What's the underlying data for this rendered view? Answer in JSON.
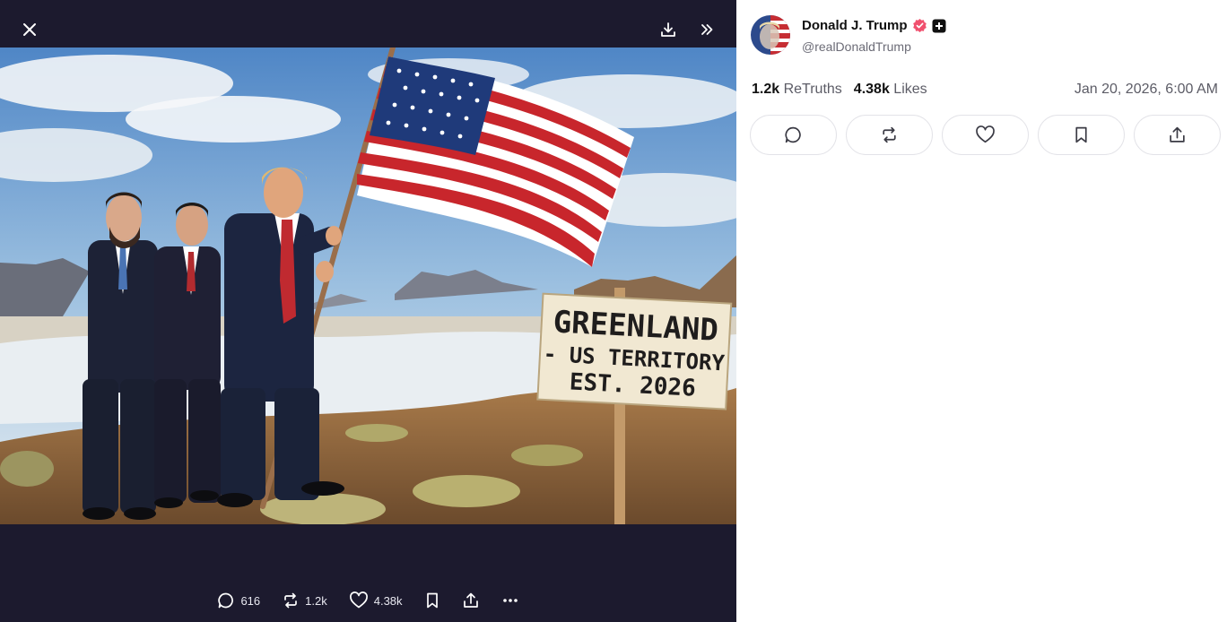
{
  "viewer": {
    "close_icon": "close-icon",
    "download_icon": "download-icon",
    "collapse_icon": "chevrons-right-icon",
    "image": {
      "sign_line1": "GREENLAND",
      "sign_line2": "- US TERRITORY",
      "sign_line3": "EST. 2026"
    },
    "bottom_bar": {
      "replies": "616",
      "retruths": "1.2k",
      "likes": "4.38k"
    }
  },
  "post": {
    "author_name": "Donald J. Trump",
    "author_handle": "@realDonaldTrump",
    "retruths_count": "1.2k",
    "retruths_label": "ReTruths",
    "likes_count": "4.38k",
    "likes_label": "Likes",
    "timestamp": "Jan 20, 2026, 6:00 AM",
    "verified_color": "#f0506e"
  }
}
